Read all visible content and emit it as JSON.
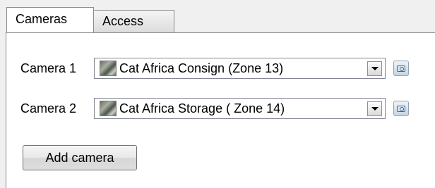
{
  "tabs": [
    {
      "label": "Cameras",
      "selected": true
    },
    {
      "label": "Access",
      "selected": false
    }
  ],
  "cameras": [
    {
      "label": "Camera 1",
      "selected_value": "Cat Africa Consign (Zone 13)",
      "thumb_icon": "camera-thumbnail"
    },
    {
      "label": "Camera 2",
      "selected_value": "Cat Africa Storage ( Zone 14)",
      "thumb_icon": "camera-thumbnail"
    }
  ],
  "add_camera_label": "Add camera",
  "icons": {
    "dropdown": "chevron-down-icon",
    "preview": "camera-preview-icon"
  },
  "colors": {
    "panel_bg": "#ffffff",
    "window_bg": "#f0f0f0",
    "border": "#8a8a8a"
  }
}
